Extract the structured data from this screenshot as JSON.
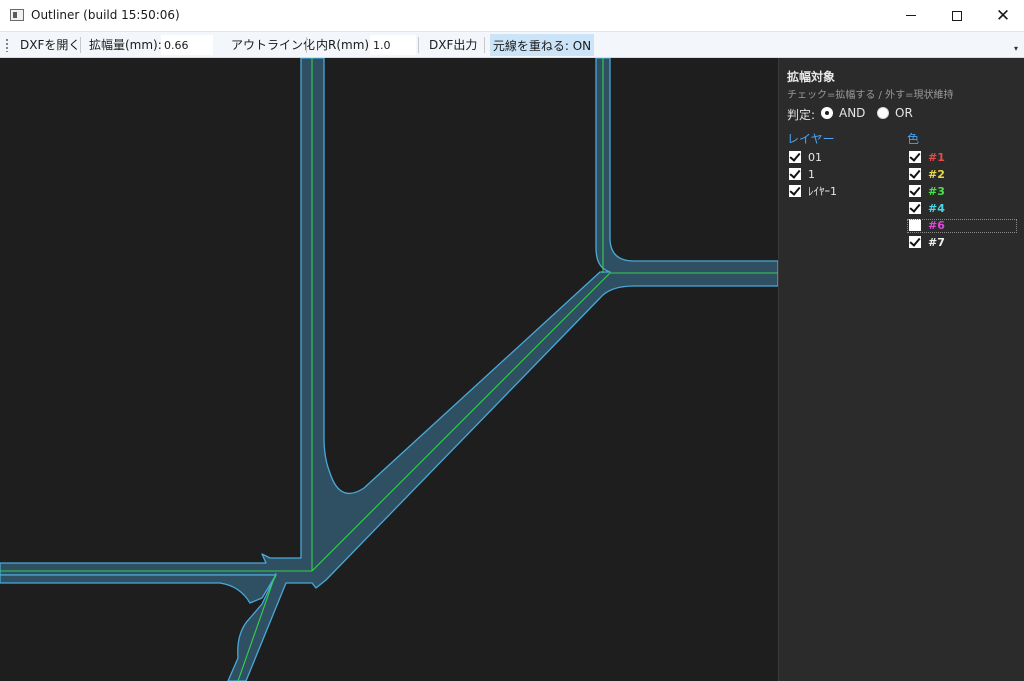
{
  "window": {
    "title": "Outliner  (build 15:50:06)"
  },
  "toolbar": {
    "open_dxf": "DXFを開く",
    "expand_label": "拡幅量(mm):",
    "expand_value": "0.66",
    "outline_button": "アウトライン化",
    "inner_r_label": "内R(mm):",
    "inner_r_value": "1.0",
    "export_dxf": "DXF出力",
    "overlay_toggle": "元線を重ねる: ON"
  },
  "panel": {
    "title": "拡幅対象",
    "hint": "チェック=拡幅する / 外す=現状維持",
    "judge_label": "判定:",
    "judge_options": [
      {
        "label": "AND",
        "checked": true
      },
      {
        "label": "OR",
        "checked": false
      }
    ],
    "layers_header": "レイヤー",
    "layers": [
      {
        "label": "01",
        "checked": true
      },
      {
        "label": "1",
        "checked": true
      },
      {
        "label": "ﾚｲﾔｰ1",
        "checked": true
      }
    ],
    "colors_header": "色",
    "colors": [
      {
        "label": "#1",
        "checked": true,
        "color": "#e84a4a"
      },
      {
        "label": "#2",
        "checked": true,
        "color": "#e8d84a"
      },
      {
        "label": "#3",
        "checked": true,
        "color": "#4ae04a"
      },
      {
        "label": "#4",
        "checked": true,
        "color": "#4ad8e8"
      },
      {
        "label": "#6",
        "checked": false,
        "color": "#d84ad8"
      },
      {
        "label": "#7",
        "checked": true,
        "color": "#f0f0f0"
      }
    ]
  },
  "canvas_colors": {
    "background": "#1e1e1e",
    "outline_fill": "#2e5062",
    "outline_stroke": "#4aa8d8",
    "centerline": "#37d14a"
  }
}
